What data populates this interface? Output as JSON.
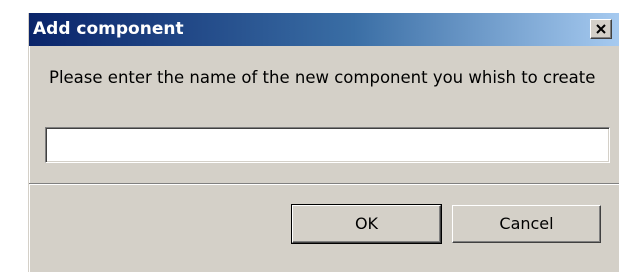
{
  "window": {
    "title": "Add component",
    "close_icon": "close-icon"
  },
  "form": {
    "prompt": "Please enter the name of the new component you whish to create",
    "name_value": "",
    "name_placeholder": ""
  },
  "buttons": {
    "ok_label": "OK",
    "cancel_label": "Cancel"
  },
  "colors": {
    "titlebar_start": "#0a246a",
    "titlebar_end": "#a6caf0",
    "dialog_face": "#d4d0c8"
  }
}
